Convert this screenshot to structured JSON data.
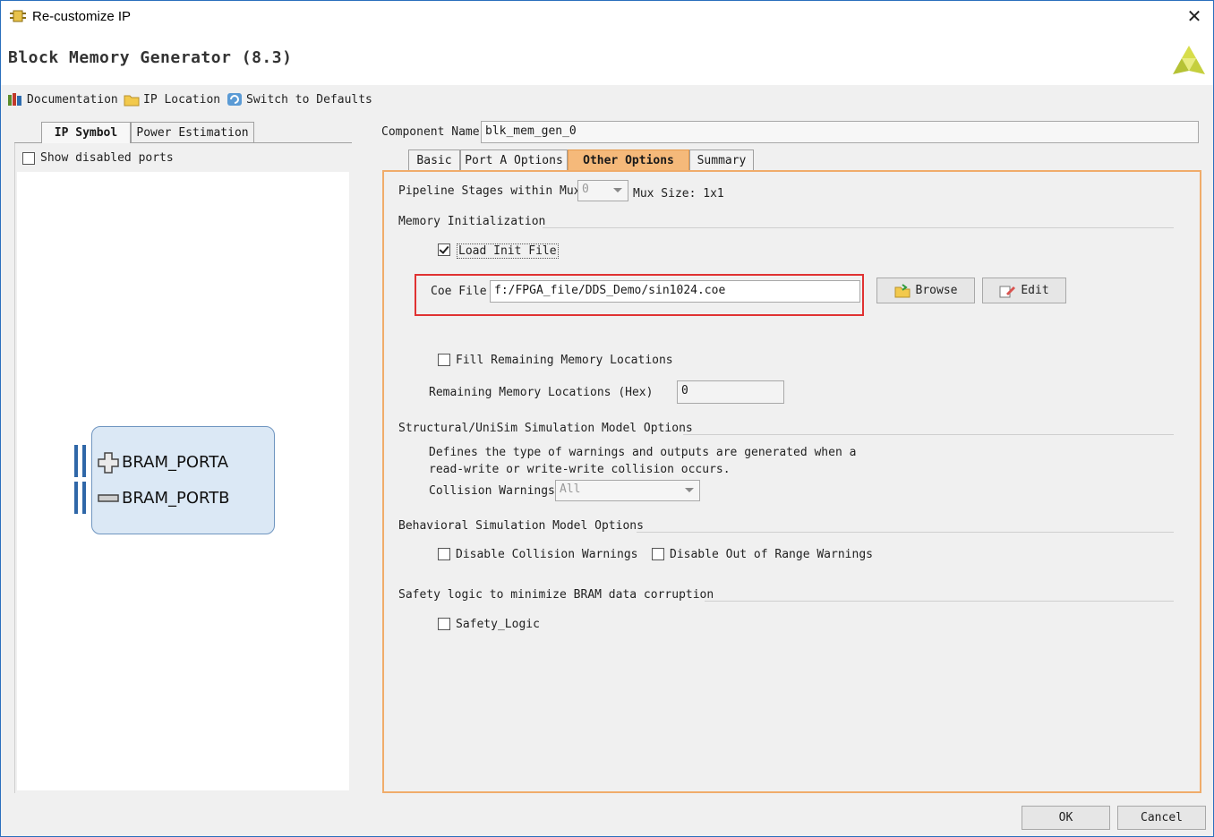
{
  "window": {
    "title": "Re-customize IP",
    "close_glyph": "✕"
  },
  "header": {
    "app_title": "Block Memory Generator (8.3)",
    "logo_icon": "xilinx-logo-icon"
  },
  "toolbar": {
    "documentation": "Documentation",
    "ip_location": "IP Location",
    "switch_defaults": "Switch to Defaults"
  },
  "left_panel": {
    "tabs": [
      "IP Symbol",
      "Power Estimation"
    ],
    "show_disabled_ports": "Show disabled ports",
    "ports": [
      "BRAM_PORTA",
      "BRAM_PORTB"
    ],
    "port_glyphs": [
      "plus-icon",
      "minus-icon"
    ]
  },
  "component": {
    "label": "Component Name",
    "value": "blk_mem_gen_0"
  },
  "tabs": [
    "Basic",
    "Port A Options",
    "Other Options",
    "Summary"
  ],
  "active_tab": "Other Options",
  "pipeline": {
    "label": "Pipeline Stages within Mux",
    "value": "0",
    "mux_size": "Mux Size: 1x1"
  },
  "memory_init": {
    "title": "Memory Initialization",
    "load_init_label": "Load Init File",
    "load_init_checked": true,
    "coe_label": "Coe File",
    "coe_value": "f:/FPGA_file/DDS_Demo/sin1024.coe",
    "browse": "Browse",
    "edit": "Edit",
    "fill_label": "Fill Remaining Memory Locations",
    "fill_checked": false,
    "remaining_label": "Remaining Memory Locations (Hex)",
    "remaining_value": "0"
  },
  "structural": {
    "title": "Structural/UniSim Simulation Model Options",
    "desc_line1": "Defines the type of warnings and outputs are generated when a",
    "desc_line2": "read-write or write-write collision occurs.",
    "collision_label": "Collision Warnings",
    "collision_value": "All"
  },
  "behavioral": {
    "title": "Behavioral Simulation Model Options",
    "disable_collision": "Disable Collision Warnings",
    "disable_range": "Disable Out of Range Warnings"
  },
  "safety": {
    "title": "Safety logic to minimize BRAM data corruption",
    "safety_logic": "Safety_Logic"
  },
  "footer": {
    "ok": "OK",
    "cancel": "Cancel"
  },
  "colors": {
    "accent_tab": "#f5b97a",
    "panel_border": "#f0ac6a",
    "highlight": "#e03232",
    "block_fill": "#dbe8f5"
  }
}
